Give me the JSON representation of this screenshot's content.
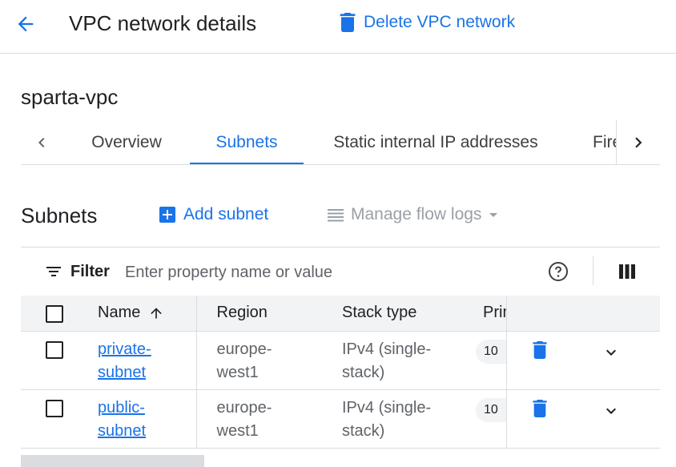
{
  "header": {
    "back_icon": "arrow-back-icon",
    "title": "VPC network details",
    "delete_label": "Delete VPC network",
    "delete_icon": "trash-icon",
    "accent_color": "#1a73e8"
  },
  "vpc_name": "sparta-vpc",
  "tabs": [
    {
      "label": "Overview",
      "active": false
    },
    {
      "label": "Subnets",
      "active": true
    },
    {
      "label": "Static internal IP addresses",
      "active": false
    },
    {
      "label": "Fire",
      "active": false
    }
  ],
  "subnets_section": {
    "title": "Subnets",
    "add_label": "Add subnet",
    "flow_logs_label": "Manage flow logs",
    "flow_logs_disabled": true
  },
  "filter": {
    "label": "Filter",
    "placeholder": "Enter property name or value"
  },
  "table": {
    "columns": [
      "Name",
      "Region",
      "Stack type",
      "Prim"
    ],
    "sort": {
      "column": "Name",
      "direction": "ascending"
    },
    "rows": [
      {
        "name_line1": "private-",
        "name_line2": "subnet",
        "region_line1": "europe-",
        "region_line2": "west1",
        "stack_line1": "IPv4 (single-",
        "stack_line2": "stack)",
        "prim": "10"
      },
      {
        "name_line1": "public-",
        "name_line2": "subnet",
        "region_line1": "europe-",
        "region_line2": "west1",
        "stack_line1": "IPv4 (single-",
        "stack_line2": "stack)",
        "prim": "10"
      }
    ]
  }
}
